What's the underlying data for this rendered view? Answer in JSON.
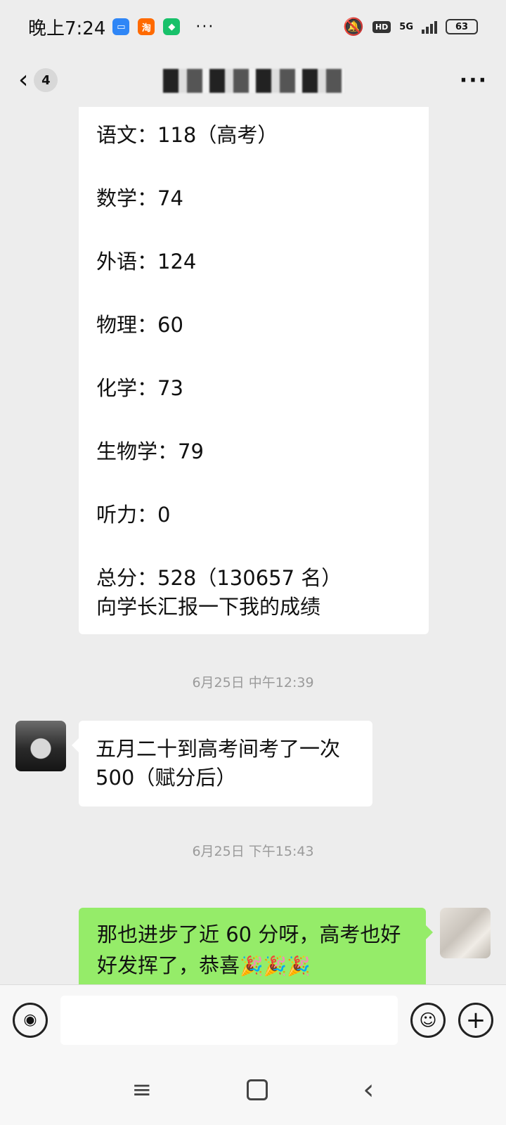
{
  "status_bar": {
    "time": "晚上7:24",
    "app_icons": [
      {
        "name": "calendar-app-icon",
        "color": "#2f86f6"
      },
      {
        "name": "taobao-app-icon",
        "label": "淘",
        "color": "#ff6a00"
      },
      {
        "name": "security-app-icon",
        "color": "#18c16a"
      }
    ],
    "dots": "···",
    "network": "5G",
    "hd": "HD",
    "battery": "63"
  },
  "header": {
    "back_icon": "chevron-left-icon",
    "unread_count": "4",
    "more_icon": "more-dots-icon"
  },
  "messages": {
    "score_lines": [
      "语文：118（高考）",
      "数学：74",
      "外语：124",
      "物理：60",
      "化学：73",
      "生物学：79",
      "听力：0",
      "总分：528（130657 名）"
    ],
    "score_note": "向学长汇报一下我的成绩",
    "timestamp1": "6月25日 中午12:39",
    "msg2_line1": "五月二十到高考间考了一次",
    "msg2_line2": "500（赋分后）",
    "timestamp2": "6月25日 下午15:43",
    "msg3_line1": "那也进步了近 60 分呀，高考也好",
    "msg3_line2": "好发挥了，恭喜",
    "party_emoji": "🎉🎉🎉"
  },
  "input_bar": {
    "voice_icon": "voice-icon",
    "emoji_icon": "emoji-icon",
    "plus_icon": "plus-icon"
  },
  "colors": {
    "background": "#ededed",
    "bubble_self": "#95ec69",
    "bubble_other": "#ffffff",
    "timestamp": "#9a9a9a"
  }
}
